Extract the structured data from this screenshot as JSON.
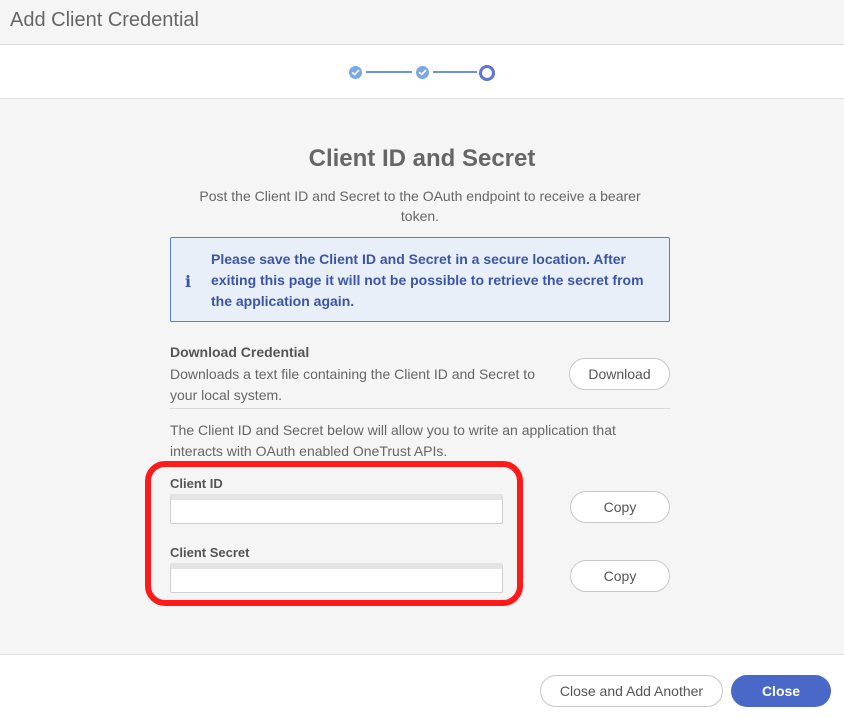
{
  "header": {
    "title": "Add Client Credential"
  },
  "stepper": {
    "total_steps": 3,
    "current_step": 3
  },
  "content": {
    "title": "Client ID and Secret",
    "subtitle": "Post the Client ID and Secret to the OAuth endpoint to receive a bearer token."
  },
  "alert": {
    "icon": "info-icon",
    "text": "Please save the Client ID and Secret in a secure location. After exiting this page it will not be possible to retrieve the secret from the application again."
  },
  "download": {
    "title": "Download Credential",
    "description": "Downloads a text file containing the Client ID and Secret to your local system.",
    "button_label": "Download"
  },
  "info_text": "The Client ID and Secret below will allow you to write an application that interacts with OAuth enabled OneTrust APIs.",
  "fields": {
    "client_id": {
      "label": "Client ID",
      "value": "",
      "copy_label": "Copy"
    },
    "client_secret": {
      "label": "Client Secret",
      "value": "",
      "copy_label": "Copy"
    }
  },
  "footer": {
    "close_and_add_label": "Close and Add Another",
    "close_label": "Close"
  },
  "colors": {
    "accent": "#4a68c8",
    "alert_bg": "#e8eff9",
    "alert_border": "#5a80d0",
    "highlight": "#ff1a1a",
    "step_done": "#7aa7e6"
  }
}
